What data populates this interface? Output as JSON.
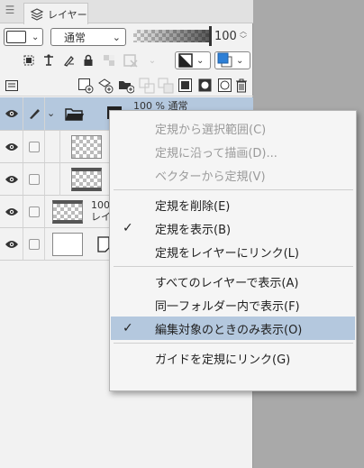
{
  "panel": {
    "tab_label": "レイヤー",
    "blend_mode": "通常",
    "opacity_value": "100",
    "opacity_level": 1.0
  },
  "icons": {
    "menu": "hamburger-icon",
    "layers_tab": "layers-icon"
  },
  "layers": [
    {
      "name_line1": "100 % 通常",
      "kind": "folder",
      "selected": true
    },
    {
      "name_line1": "",
      "kind": "raster"
    },
    {
      "name_line1": "",
      "kind": "raster"
    },
    {
      "name_line1": "100",
      "name_line2": "レイ",
      "kind": "raster"
    },
    {
      "name_line1": "",
      "kind": "paper"
    }
  ],
  "context_menu": {
    "items": [
      {
        "label": "定規から選択範囲(C)",
        "enabled": false,
        "checked": false
      },
      {
        "label": "定規に沿って描画(D)...",
        "enabled": false,
        "checked": false
      },
      {
        "label": "ベクターから定規(V)",
        "enabled": false,
        "checked": false
      },
      {
        "label": "定規を削除(E)",
        "enabled": true,
        "checked": false
      },
      {
        "label": "定規を表示(B)",
        "enabled": true,
        "checked": true
      },
      {
        "label": "定規をレイヤーにリンク(L)",
        "enabled": true,
        "checked": false
      },
      {
        "label": "すべてのレイヤーで表示(A)",
        "enabled": true,
        "checked": false
      },
      {
        "label": "同一フォルダー内で表示(F)",
        "enabled": true,
        "checked": false
      },
      {
        "label": "編集対象のときのみ表示(O)",
        "enabled": true,
        "checked": true,
        "highlighted": true
      },
      {
        "label": "ガイドを定規にリンク(G)",
        "enabled": true,
        "checked": false
      }
    ]
  },
  "colors": {
    "selected_row": "#b4c8de",
    "accent_blue": "#2d7fd6",
    "panel_bg": "#f2f2f2"
  }
}
